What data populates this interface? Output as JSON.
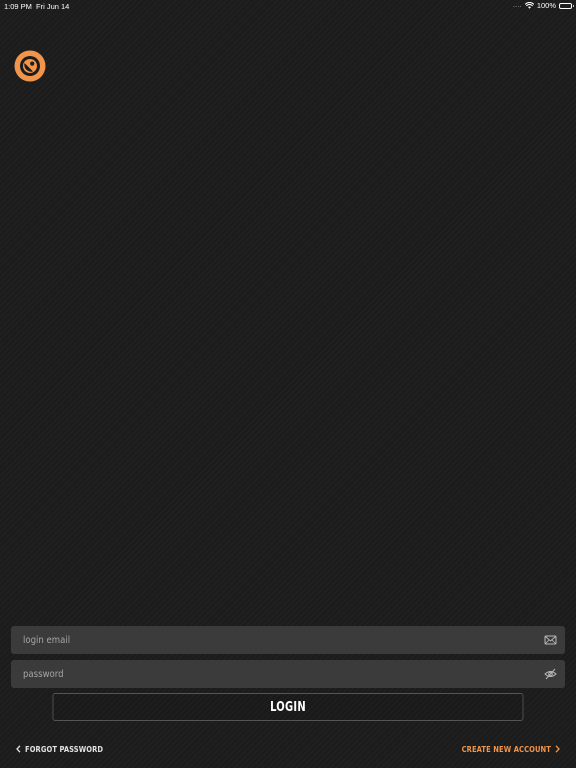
{
  "status_bar": {
    "time": "1:09 PM",
    "date": "Fri Jun 14",
    "signal_dots": "....",
    "battery_percent": "100%",
    "icons": [
      "wifi-icon",
      "battery-icon"
    ]
  },
  "branding": {
    "logo_icon": "orange-ring-logo",
    "accent_color": "#f0954b"
  },
  "login_form": {
    "email": {
      "placeholder": "login email",
      "value": "",
      "icon": "envelope-icon"
    },
    "password": {
      "placeholder": "password",
      "value": "",
      "icon": "eye-slash-icon"
    },
    "submit_label": "LOGIN"
  },
  "links": {
    "forgot_password": "FORGOT PASSWORD",
    "create_account": "CREATE NEW ACCOUNT"
  },
  "colors": {
    "background": "#1c1c1c",
    "field_background": "#3b3b3b",
    "link_accent": "#f0954b"
  }
}
